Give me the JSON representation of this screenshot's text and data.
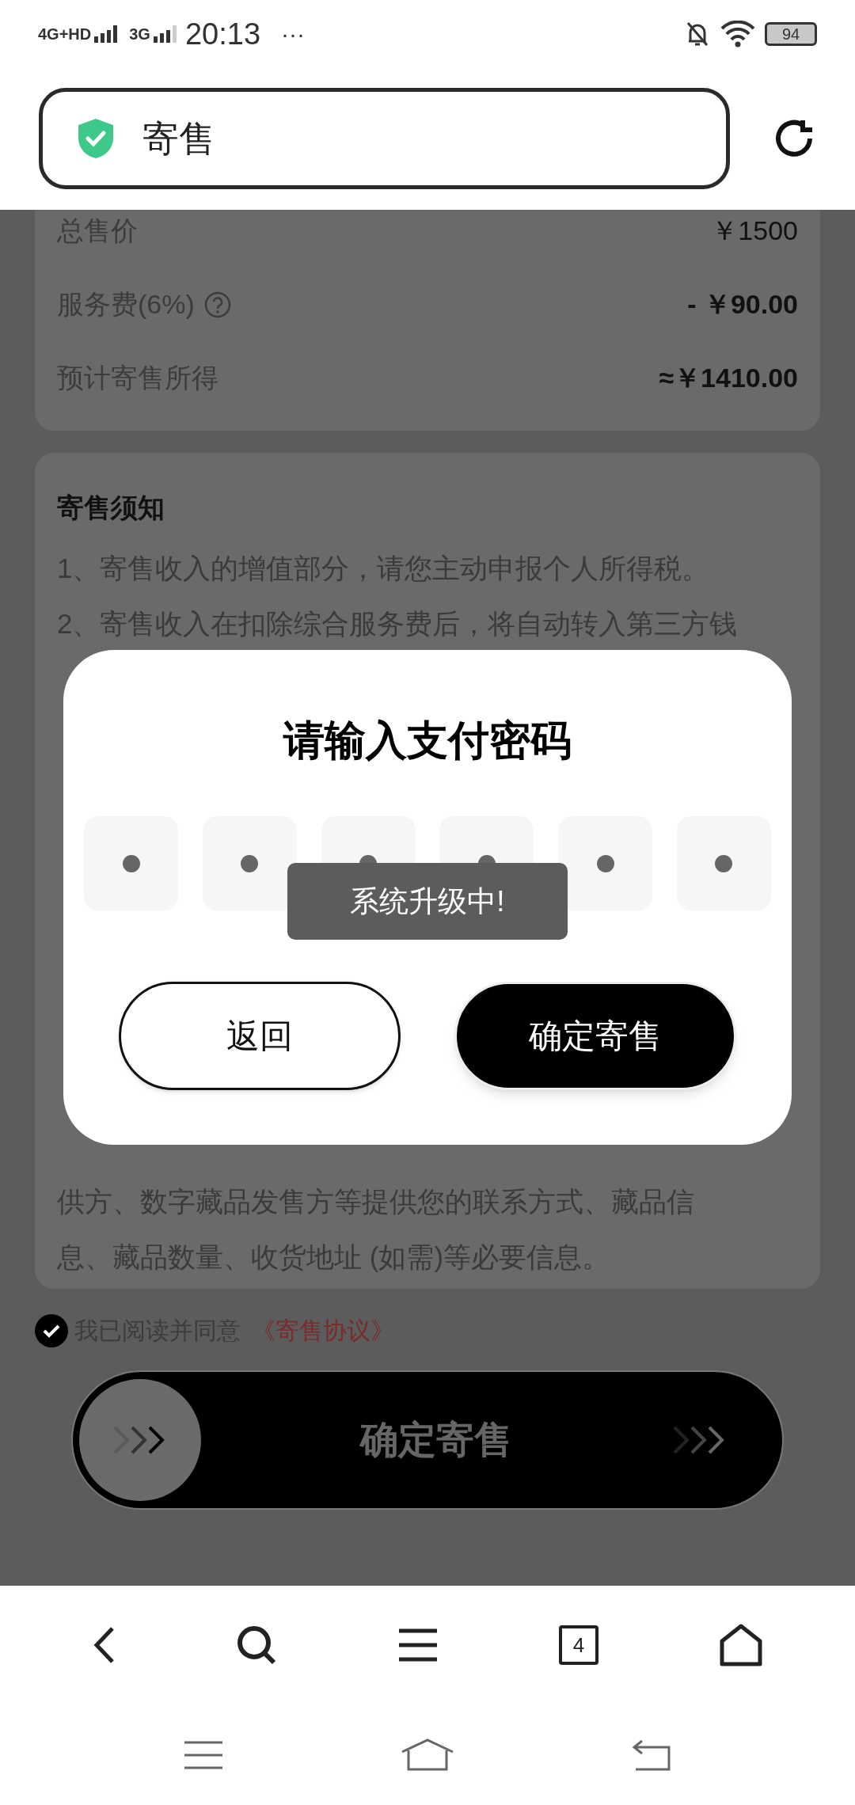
{
  "status_bar": {
    "network_1": "4G+HD",
    "network_2": "3G",
    "time": "20:13",
    "more": "···",
    "battery": "94"
  },
  "address_bar": {
    "title": "寄售"
  },
  "price_card": {
    "rows": [
      {
        "label": "总售价",
        "value": "￥1500",
        "help": false
      },
      {
        "label": "服务费(6%)",
        "value": "- ￥90.00",
        "help": true
      },
      {
        "label": "预计寄售所得",
        "value": "≈￥1410.00",
        "help": false
      }
    ]
  },
  "notice": {
    "title": "寄售须知",
    "lines_top": [
      "1、寄售收入的增值部分，请您主动申报个人所得税。",
      "2、寄售收入在扣除综合服务费后，将自动转入第三方钱"
    ],
    "lines_bottom": [
      "供方、数字藏品发售方等提供您的联系方式、藏品信",
      "息、藏品数量、收货地址 (如需)等必要信息。"
    ]
  },
  "agreement": {
    "checked": true,
    "text": "我已阅读并同意",
    "link": "《寄售协议》"
  },
  "slide_button": {
    "label": "确定寄售"
  },
  "dialog": {
    "title": "请输入支付密码",
    "digits": [
      {
        "filled": true
      },
      {
        "filled": true
      },
      {
        "filled": true
      },
      {
        "filled": true
      },
      {
        "filled": true
      },
      {
        "filled": true
      }
    ],
    "toast": "系统升级中!",
    "buttons": [
      {
        "label": "返回",
        "kind": "secondary"
      },
      {
        "label": "确定寄售",
        "kind": "primary"
      }
    ]
  },
  "browser_nav": {
    "tab_count": "4"
  }
}
